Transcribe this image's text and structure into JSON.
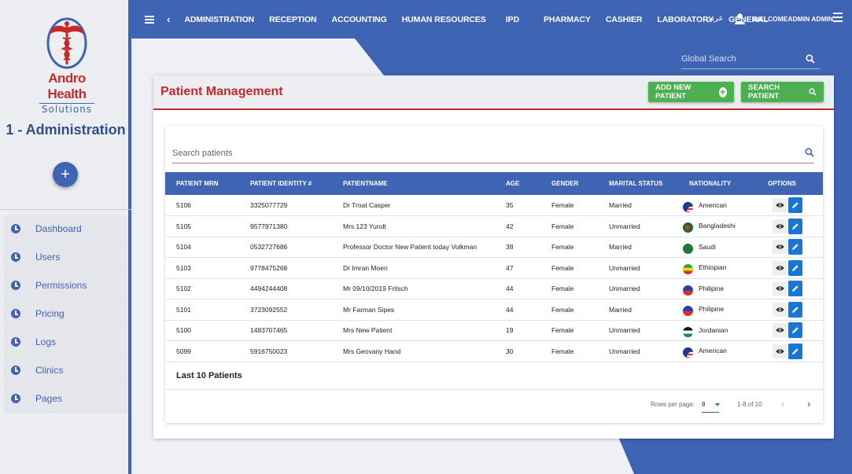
{
  "sidebar": {
    "brand_name": "Andro Health",
    "brand_sub": "Solutions",
    "org_title": "1 - Administration",
    "add_label": "+",
    "items": [
      {
        "label": "Dashboard"
      },
      {
        "label": "Users"
      },
      {
        "label": "Permissions"
      },
      {
        "label": "Pricing"
      },
      {
        "label": "Logs"
      },
      {
        "label": "Clinics"
      },
      {
        "label": "Pages"
      }
    ]
  },
  "topbar": {
    "back_glyph": "‹",
    "nav": [
      "ADMINISTRATION",
      "RECEPTION",
      "ACCOUNTING",
      "HUMAN RESOURCES",
      "IPD",
      "PHARMACY",
      "CASHIER",
      "LABORATORY",
      "GENERAL"
    ],
    "language": "عربي",
    "user_name": "WELCOMEADMIN ADMIN"
  },
  "global_search": {
    "placeholder": "Global Search"
  },
  "card": {
    "title": "Patient Management",
    "add_button": "ADD NEW PATIENT",
    "search_button": "SEARCH PATIENT",
    "search_placeholder": "Search patients"
  },
  "table": {
    "columns": [
      "PATIENT MRN",
      "PATIENT IDENTITY #",
      "PATIENTNAME",
      "AGE",
      "GENDER",
      "MARITAL STATUS",
      "NATIONALITY",
      "OPTIONS"
    ],
    "rows": [
      {
        "mrn": "5106",
        "identity": "3325077729",
        "name": "Dr Troat Casper",
        "age": "35",
        "gender": "Female",
        "marital": "Married",
        "nationality": "American",
        "flag": "us"
      },
      {
        "mrn": "5105",
        "identity": "9577971380",
        "name": "Mrs 123 Yundt",
        "age": "42",
        "gender": "Female",
        "marital": "Unmarried",
        "nationality": "Bangladeshi",
        "flag": "bd"
      },
      {
        "mrn": "5104",
        "identity": "0532727686",
        "name": "Professor Doctor New Patient today Volkman",
        "age": "38",
        "gender": "Female",
        "marital": "Married",
        "nationality": "Saudi",
        "flag": "sa"
      },
      {
        "mrn": "5103",
        "identity": "9778475268",
        "name": "Dr Imran Moen",
        "age": "47",
        "gender": "Female",
        "marital": "Unmarried",
        "nationality": "Ethiopian",
        "flag": "et"
      },
      {
        "mrn": "5102",
        "identity": "4494244408",
        "name": "Mr 09/10/2019 Fritsch",
        "age": "44",
        "gender": "Female",
        "marital": "Unmarried",
        "nationality": "Philipine",
        "flag": "ph"
      },
      {
        "mrn": "5101",
        "identity": "3723092552",
        "name": "Mr Farman Sipes",
        "age": "44",
        "gender": "Female",
        "marital": "Married",
        "nationality": "Philipine",
        "flag": "ph"
      },
      {
        "mrn": "5100",
        "identity": "1483707465",
        "name": "Mrs New Patient",
        "age": "19",
        "gender": "Female",
        "marital": "Unmarried",
        "nationality": "Jordanian",
        "flag": "jo"
      },
      {
        "mrn": "5099",
        "identity": "5916750023",
        "name": "Mrs Geovany Hand",
        "age": "30",
        "gender": "Female",
        "marital": "Unmarried",
        "nationality": "American",
        "flag": "us"
      }
    ]
  },
  "footer": {
    "caption": "Last 10 Patients",
    "rows_per_page_label": "Rows per page:",
    "rows_per_page_value": "8",
    "range": "1-8 of 10",
    "prev_glyph": "‹",
    "next_glyph": "›"
  },
  "colors": {
    "primary": "#3f64b3",
    "danger": "#c62828",
    "success": "#4caf50",
    "edit": "#1976d2"
  }
}
